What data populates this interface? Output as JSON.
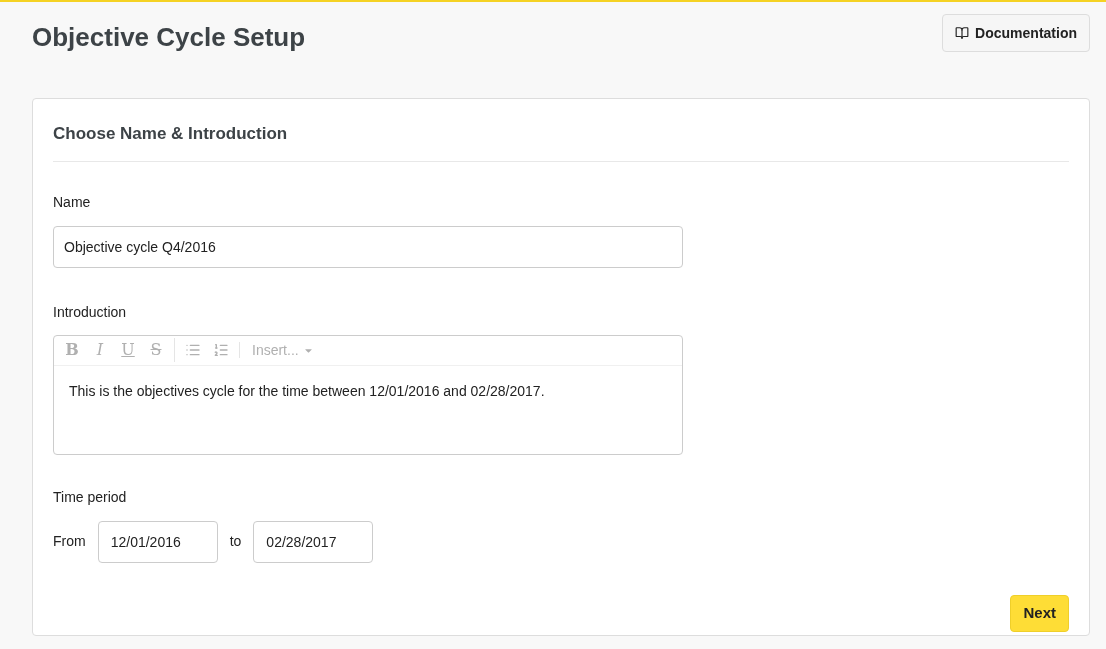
{
  "page": {
    "title": "Objective Cycle Setup",
    "documentation_button": "Documentation"
  },
  "card": {
    "heading": "Choose Name & Introduction"
  },
  "name_field": {
    "label": "Name",
    "value": "Objective cycle Q4/2016"
  },
  "introduction": {
    "label": "Introduction",
    "toolbar": [
      {
        "kind": "format",
        "label": "B"
      },
      {
        "kind": "format",
        "label": "I"
      },
      {
        "kind": "format",
        "label": "U"
      },
      {
        "kind": "format",
        "label": "S"
      },
      {
        "kind": "bullet-list"
      },
      {
        "kind": "numbered-list"
      },
      {
        "kind": "dropdown",
        "label": "Insert..."
      }
    ],
    "value": "This is the objectives cycle for the time between 12/01/2016 and 02/28/2017."
  },
  "time_period": {
    "label": "Time period",
    "from_label": "From",
    "from_value": "12/01/2016",
    "to_label": "to",
    "to_value": "02/28/2017"
  },
  "next_button": "Next"
}
